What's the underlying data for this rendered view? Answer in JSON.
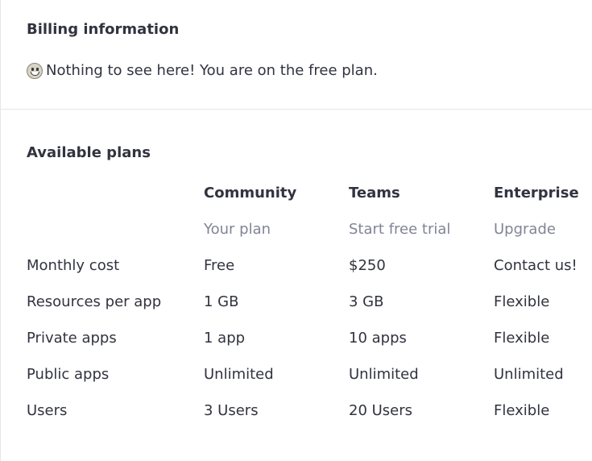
{
  "billing": {
    "heading": "Billing information",
    "message": "Nothing to see here! You are on the free plan."
  },
  "plans": {
    "heading": "Available plans",
    "columns": [
      {
        "name": "Community",
        "action": "Your plan"
      },
      {
        "name": "Teams",
        "action": "Start free trial"
      },
      {
        "name": "Enterprise",
        "action": "Upgrade"
      }
    ],
    "rows": [
      {
        "label": "Monthly cost",
        "values": [
          "Free",
          "$250",
          "Contact us!"
        ]
      },
      {
        "label": "Resources per app",
        "values": [
          "1 GB",
          "3 GB",
          "Flexible"
        ]
      },
      {
        "label": "Private apps",
        "values": [
          "1 app",
          "10 apps",
          "Flexible"
        ]
      },
      {
        "label": "Public apps",
        "values": [
          "Unlimited",
          "Unlimited",
          "Unlimited"
        ]
      },
      {
        "label": "Users",
        "values": [
          "3 Users",
          "20 Users",
          "Flexible"
        ]
      }
    ]
  }
}
